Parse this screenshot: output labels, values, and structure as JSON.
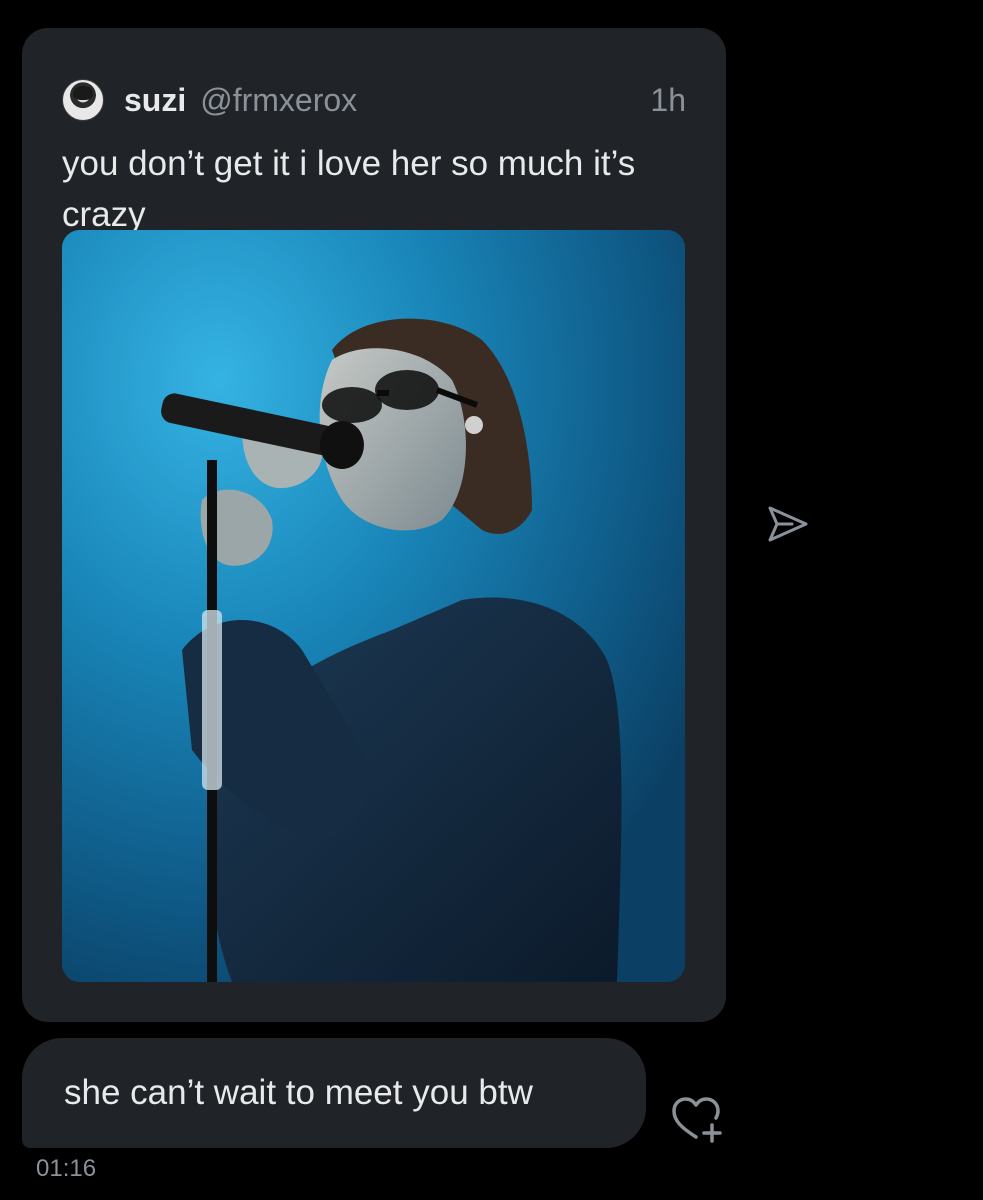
{
  "quoted_post": {
    "display_name": "suzi",
    "handle": "@frmxerox",
    "time_ago": "1h",
    "text": "you don’t get it i love her so much it’s crazy",
    "media": {
      "icon": "concert-photo"
    }
  },
  "message": {
    "text": "she can’t wait to meet you btw",
    "timestamp": "01:16"
  },
  "icons": {
    "share": "share-icon",
    "react": "add-reaction-icon"
  },
  "colors": {
    "background": "#000000",
    "bubble": "#202327",
    "text_primary": "#e7e9ea",
    "text_secondary": "#8b9198",
    "photo_blue": "#1a7aa8"
  }
}
